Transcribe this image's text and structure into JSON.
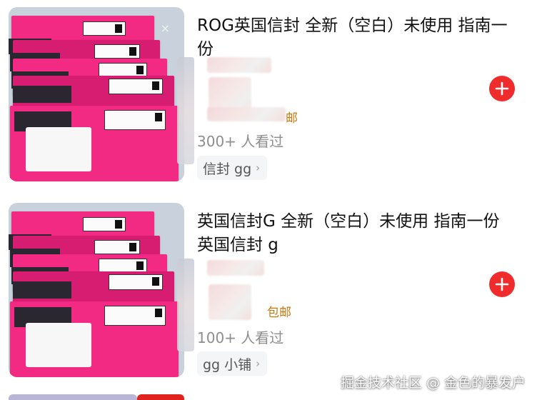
{
  "products": [
    {
      "title": "ROG英国信封 全新（空白）未使用 指南一份",
      "shipping": "邮",
      "views": "300+ 人看过",
      "shop": "信封 gg",
      "shop_chevron": "›",
      "thumb_close": "×"
    },
    {
      "title": "英国信封G 全新（空白）未使用 指南一份 英国信封 g",
      "shipping": "包邮",
      "views": "100+ 人看过",
      "shop": "gg 小铺",
      "shop_chevron": "›"
    }
  ],
  "icons": {
    "add": "plus-icon",
    "close": "close-icon"
  },
  "colors": {
    "accent": "#ef2b2b",
    "envelope": "#f22a83",
    "shipping": "#c9780f"
  },
  "watermark": "掘金技术社区 @ 金色的暴发户"
}
